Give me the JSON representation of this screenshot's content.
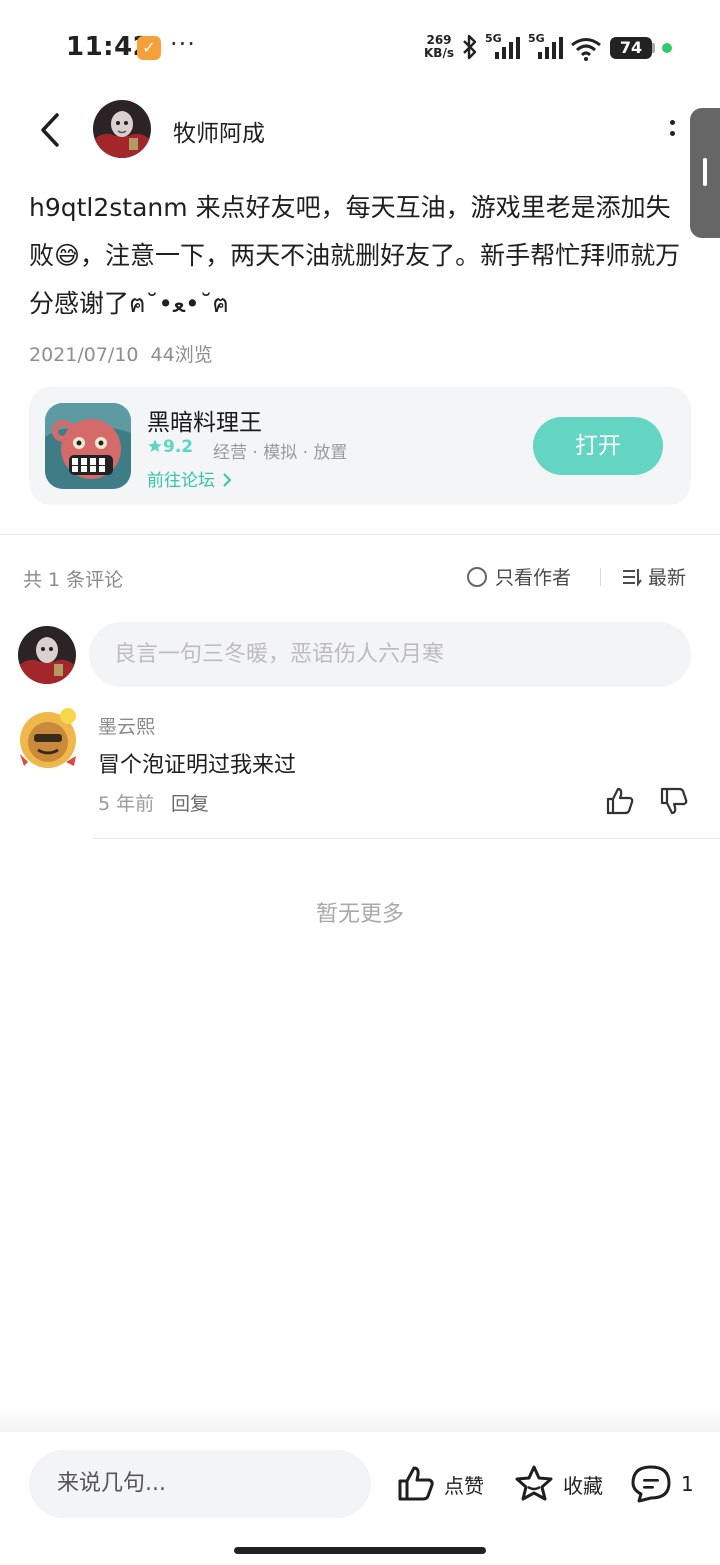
{
  "status_bar": {
    "time": "11:42",
    "speed_value": "269",
    "speed_unit": "KB/s",
    "signal_label_1": "5G",
    "signal_label_2": "5G",
    "battery": "74"
  },
  "header": {
    "author_name": "牧师阿成"
  },
  "post": {
    "body": "h9qtl2stanm 来点好友吧，每天互油，游戏里老是添加失败😅，注意一下，两天不油就删好友了。新手帮忙拜师就万分感谢了ฅ˘•ﻌ•˘ฅ",
    "date": "2021/07/10",
    "views": "44浏览"
  },
  "game_card": {
    "title": "黑暗料理王",
    "rating": "9.2",
    "tags": "经营 · 模拟 · 放置",
    "forum_link": "前往论坛",
    "open_button": "打开"
  },
  "comments_header": {
    "count": "共 1 条评论",
    "only_author": "只看作者",
    "sort": "最新"
  },
  "comment_input": {
    "placeholder": "良言一句三冬暖，恶语伤人六月寒"
  },
  "comments": [
    {
      "user": "墨云熙",
      "text": "冒个泡证明过我来过",
      "time": "5 年前",
      "reply": "回复"
    }
  ],
  "no_more": "暂无更多",
  "bottom_bar": {
    "input_placeholder": "来说几句...",
    "like": "点赞",
    "favorite": "收藏",
    "comment_count": "1"
  },
  "colors": {
    "accent": "#63d5c2",
    "accent_text": "#35c4ad",
    "star": "#5bd6c3"
  }
}
